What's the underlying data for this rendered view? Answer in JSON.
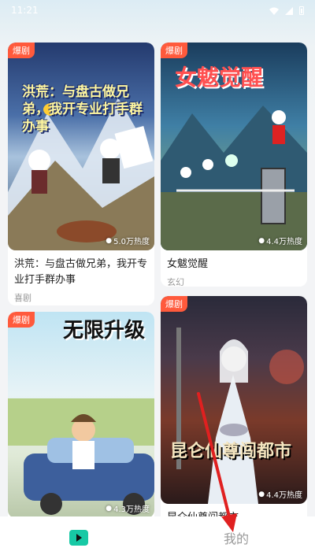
{
  "status": {
    "time": "11:21"
  },
  "colors": {
    "accent": "#17c9a5",
    "tag": "#ff5a3c",
    "arrow": "#e02020"
  },
  "cards": [
    {
      "tag": "爆剧",
      "overlay": "洪荒：与盘古做兄弟，我开专业打手群办事",
      "heat": "5.0万热度",
      "title": "洪荒：与盘古做兄弟，我开专业打手群办事",
      "genre": "喜剧"
    },
    {
      "tag": "爆剧",
      "overlay": "女魃觉醒",
      "heat": "4.4万热度",
      "title": "女魃觉醒",
      "genre": "玄幻"
    },
    {
      "tag": "爆剧",
      "overlay": "无限升级",
      "heat": "4.3万热度"
    },
    {
      "tag": "爆剧",
      "overlay": "昆仑仙尊闯都市",
      "heat": "4.4万热度",
      "title": "昆仑仙尊闯都市"
    }
  ],
  "tabs": {
    "me": "我的",
    "home_icon": "tv-play-icon"
  }
}
